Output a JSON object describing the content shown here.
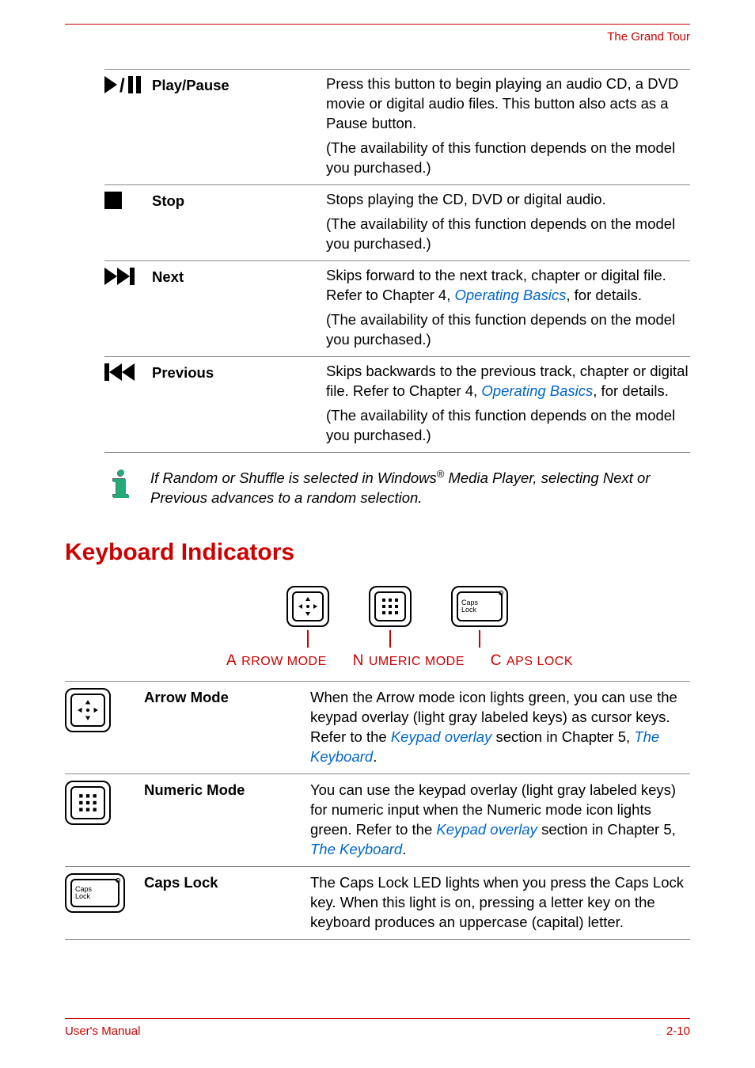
{
  "header": {
    "section": "The Grand Tour"
  },
  "footer": {
    "left": "User's Manual",
    "right": "2-10"
  },
  "controls": [
    {
      "name": "Play/Pause",
      "desc1": "Press this button to begin playing an audio CD, a DVD movie or digital audio files. This button also acts as a Pause button.",
      "desc2": "(The availability of this function depends on the model you purchased.)"
    },
    {
      "name": "Stop",
      "desc1": "Stops playing the CD, DVD or digital audio.",
      "desc2": "(The availability of this function depends on the model you purchased.)"
    },
    {
      "name": "Next",
      "desc1a": "Skips forward to the next track, chapter or digital file. Refer to Chapter 4, ",
      "link1": "Operating Basics",
      "desc1b": ", for details.",
      "desc2": "(The availability of this function depends on the model you purchased.)"
    },
    {
      "name": "Previous",
      "desc1a": "Skips backwards to the previous track, chapter or digital file. Refer to Chapter 4, ",
      "link1": "Operating Basics",
      "desc1b": ", for details.",
      "desc2": "(The availability of this function depends on the model you purchased.)"
    }
  ],
  "note": {
    "part1": "If Random or Shuffle is selected in Windows",
    "sup": "®",
    "part2": " Media Player, selecting Next or Previous advances to a random selection."
  },
  "section_heading": "Keyboard Indicators",
  "figure_labels": {
    "arrow": "Arrow mode",
    "numeric": "Numeric mode",
    "caps": "Caps lock"
  },
  "indicators": [
    {
      "name": "Arrow Mode",
      "desc_a": "When the Arrow mode icon lights green, you can use the keypad overlay (light gray labeled keys) as cursor keys. Refer to the ",
      "link1": "Keypad overlay",
      "desc_b": " section in Chapter 5, ",
      "link2": "The Keyboard",
      "desc_c": "."
    },
    {
      "name": "Numeric Mode",
      "desc_a": "You can use the keypad overlay (light gray labeled keys) for numeric input when the Numeric mode icon lights green. Refer to the ",
      "link1": "Keypad overlay",
      "desc_b": " section in Chapter 5, ",
      "link2": "The Keyboard",
      "desc_c": "."
    },
    {
      "name": "Caps Lock",
      "desc_a": "The Caps Lock LED lights when you press the Caps Lock key. When this light is on, pressing a letter key on the keyboard produces an uppercase (capital) letter.",
      "link1": "",
      "desc_b": "",
      "link2": "",
      "desc_c": ""
    }
  ],
  "caps_key_label": "Caps\nLock"
}
